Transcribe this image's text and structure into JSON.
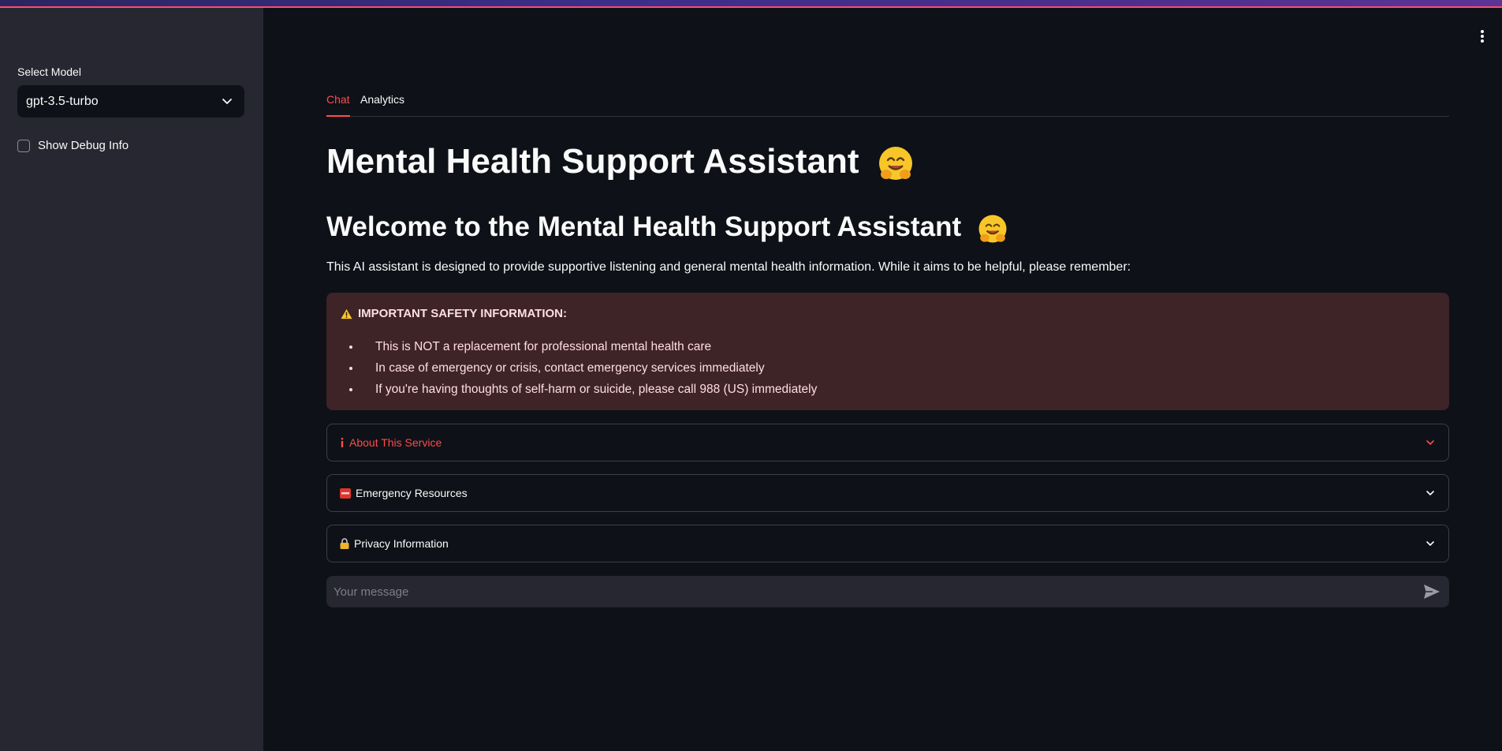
{
  "sidebar": {
    "model_label": "Select Model",
    "model_value": "gpt-3.5-turbo",
    "debug_label": "Show Debug Info"
  },
  "tabs": [
    {
      "label": "Chat"
    },
    {
      "label": "Analytics"
    }
  ],
  "main": {
    "title": "Mental Health Support Assistant",
    "welcome": "Welcome to the Mental Health Support Assistant",
    "intro": "This AI assistant is designed to provide supportive listening and general mental health information. While it aims to be helpful, please remember:",
    "alert": {
      "title": "IMPORTANT SAFETY INFORMATION:",
      "items": [
        "This is NOT a replacement for professional mental health care",
        "In case of emergency or crisis, contact emergency services immediately",
        "If you're having thoughts of self-harm or suicide, please call 988 (US) immediately"
      ]
    },
    "expanders": [
      {
        "label": "About This Service",
        "icon": "info-icon"
      },
      {
        "label": "Emergency Resources",
        "icon": "sos-icon"
      },
      {
        "label": "Privacy Information",
        "icon": "lock-icon"
      }
    ],
    "chat_placeholder": "Your message"
  },
  "colors": {
    "accent": "#ff4b4b",
    "background": "#0e1117",
    "sidebar": "#262730",
    "alert_bg": "#3e2327"
  }
}
